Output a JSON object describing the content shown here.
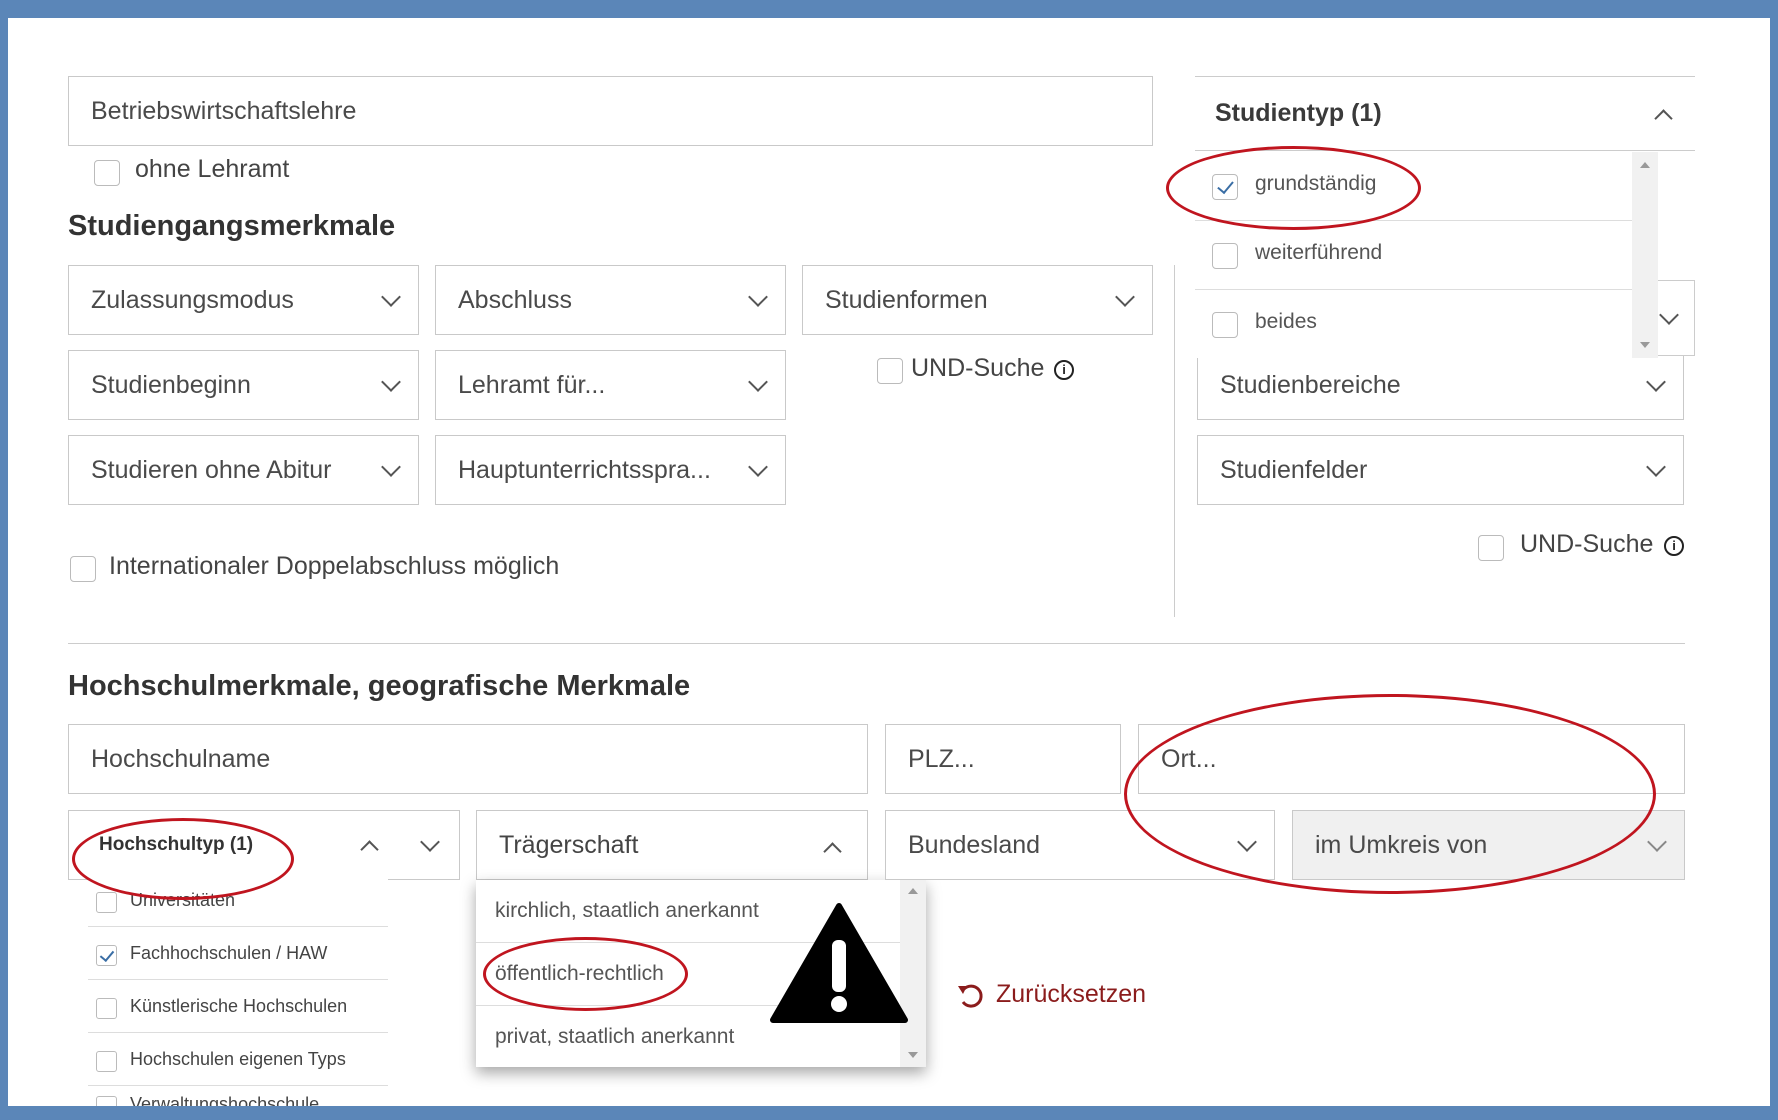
{
  "search": {
    "value": "Betriebswirtschaftslehre"
  },
  "ohne_lehramt": {
    "label": "ohne Lehramt",
    "checked": false
  },
  "studiengang": {
    "heading": "Studiengangsmerkmale",
    "dropdowns": {
      "zulassungsmodus": "Zulassungsmodus",
      "abschluss": "Abschluss",
      "studienformen": "Studienformen",
      "studienbeginn": "Studienbeginn",
      "lehramt_fuer": "Lehramt für...",
      "ohne_abitur": "Studieren ohne Abitur",
      "hauptunterricht": "Hauptunterrichtsspra..."
    },
    "und_suche": "UND-Suche",
    "doppelabschluss": "Internationaler Doppelabschluss möglich"
  },
  "studientyp": {
    "header": "Studientyp (1)",
    "options": [
      {
        "label": "grundständig",
        "checked": true
      },
      {
        "label": "weiterführend",
        "checked": false
      },
      {
        "label": "beides",
        "checked": false
      }
    ],
    "studienbereiche": "Studienbereiche",
    "studienfelder": "Studienfelder",
    "und_suche": "UND-Suche"
  },
  "hochschule": {
    "heading": "Hochschulmerkmale, geografische Merkmale",
    "name_placeholder": "Hochschulname",
    "plz_placeholder": "PLZ...",
    "ort_placeholder": "Ort...",
    "hochschultyp": {
      "header": "Hochschultyp (1)",
      "options": [
        {
          "label": "Universitäten",
          "checked": false
        },
        {
          "label": "Fachhochschulen / HAW",
          "checked": true
        },
        {
          "label": "Künstlerische Hochschulen",
          "checked": false
        },
        {
          "label": "Hochschulen eigenen Typs",
          "checked": false
        },
        {
          "label": "Verwaltungshochschule",
          "checked": false
        }
      ]
    },
    "traegerschaft": {
      "header": "Trägerschaft",
      "options": [
        "kirchlich, staatlich anerkannt",
        "öffentlich-rechtlich",
        "privat, staatlich anerkannt"
      ]
    },
    "bundesland": "Bundesland",
    "umkreis": "im Umkreis von",
    "reset": "Zurücksetzen"
  },
  "colors": {
    "frame": "#5b86b8",
    "highlight": "#c0151f",
    "reset": "#8b1c1c",
    "check": "#3a6ea5"
  }
}
